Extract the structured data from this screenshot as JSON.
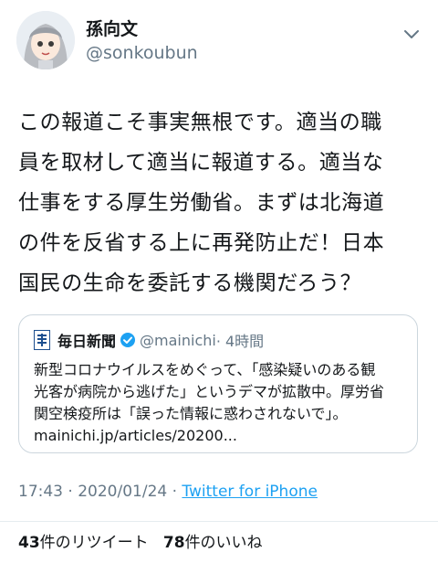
{
  "user": {
    "display_name": "孫向文",
    "handle": "@sonkoubun"
  },
  "tweet": {
    "lines": [
      "この報道こそ事実無根です。適当の職",
      "員を取材して適当に報道する。適当な",
      "仕事をする厚生労働省。まずは北海道",
      "の件を反省する上に再発防止だ！日本",
      "国民の生命を委託する機関だろう？"
    ]
  },
  "quote": {
    "name": "毎日新聞",
    "handle": "@mainichi",
    "time": "· 4時間",
    "body_lines": [
      "新型コロナウイルスをめぐって、「感染疑いのある観",
      "光客が病院から逃げた」というデマが拡散中。厚労省",
      "関空検疫所は「誤った情報に惑わされないで」。",
      "mainichi.jp/articles/20200..."
    ]
  },
  "meta": {
    "time": "17:43",
    "date": "2020/01/24",
    "separator": "·",
    "source": "Twitter for iPhone"
  },
  "stats": {
    "retweets": "43",
    "retweets_label": "件のリツイート",
    "likes": "78",
    "likes_label": "件のいいね"
  },
  "colors": {
    "accent": "#1da1f2",
    "secondary_text": "#657786",
    "border": "#ccd6dd"
  },
  "icons": {
    "menu": "chevron-down-icon",
    "verified": "verified-badge-icon",
    "quote_logo": "mainichi-logo-icon"
  }
}
